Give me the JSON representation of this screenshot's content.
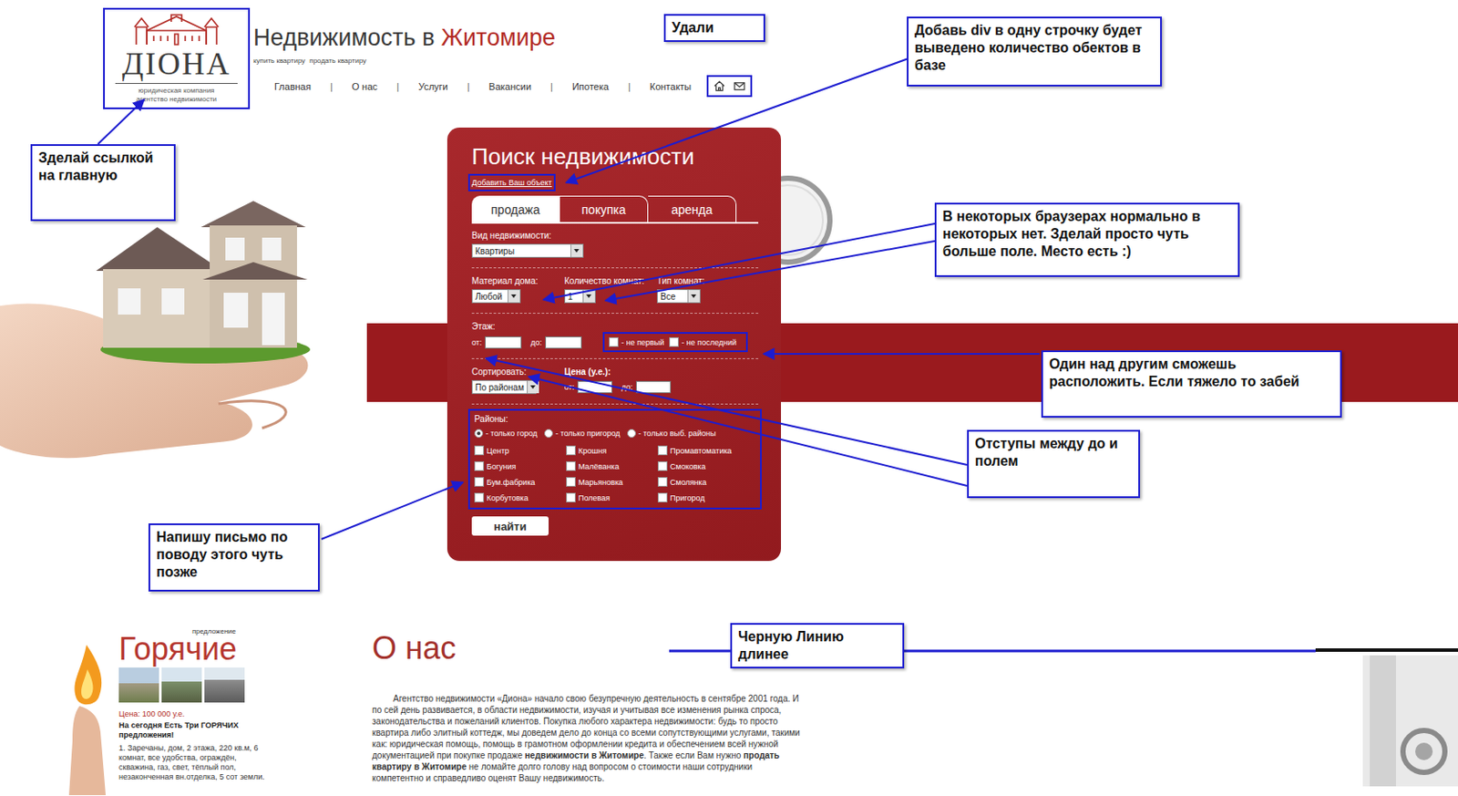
{
  "logo": {
    "name": "ДІОНА",
    "subtitle": [
      "юридическая компания",
      "агентство недвижимости"
    ],
    "highlighted": true
  },
  "site_title": {
    "text": "Недвижимость в ",
    "city": "Житомире"
  },
  "sub_links": [
    "купить квартиру",
    "продать квартиру"
  ],
  "nav": [
    "Главная",
    "О нас",
    "Услуги",
    "Вакансии",
    "Ипотека",
    "Контакты"
  ],
  "nav_separator": "|",
  "header_icons": {
    "highlighted": true
  },
  "search": {
    "title": "Поиск недвижимости",
    "add_link": {
      "label": "Добавить Ваш объект",
      "highlighted": true
    },
    "tabs": [
      {
        "label": "продажа",
        "selected": true
      },
      {
        "label": "покупка",
        "selected": false
      },
      {
        "label": "аренда",
        "selected": false
      }
    ],
    "property_type": {
      "label": "Вид недвижимости:",
      "value": "Квартиры"
    },
    "filters": [
      {
        "label": "Материал дома:",
        "value": "Любой"
      },
      {
        "label": "Количество комнат:",
        "value": "1"
      },
      {
        "label": "Тип комнат:",
        "value": "Все"
      }
    ],
    "floor": {
      "label": "Этаж:",
      "from": "от:",
      "to": "до:",
      "options_highlighted": true,
      "options": [
        {
          "label": "- не первый",
          "checked": false
        },
        {
          "label": "- не последний",
          "checked": false
        }
      ]
    },
    "sort": {
      "label": "Сортировать:",
      "value": "По районам"
    },
    "price": {
      "label": "Цена (у.е.):",
      "from": "от:",
      "to": "до:"
    },
    "districts": {
      "label": "Районы:",
      "highlighted": true,
      "scopes": [
        {
          "label": "- только город",
          "selected": true
        },
        {
          "label": "- только пригород",
          "selected": false
        },
        {
          "label": "- только выб. районы",
          "selected": false
        }
      ],
      "items": [
        {
          "label": "Центр",
          "checked": false
        },
        {
          "label": "Крошня",
          "checked": false
        },
        {
          "label": "Промавтоматика",
          "checked": false
        },
        {
          "label": "Богуния",
          "checked": false
        },
        {
          "label": "Малёванка",
          "checked": false
        },
        {
          "label": "Смоковка",
          "checked": false
        },
        {
          "label": "Бум.фабрика",
          "checked": false
        },
        {
          "label": "Марьяновка",
          "checked": false
        },
        {
          "label": "Смолянка",
          "checked": false
        },
        {
          "label": "Корбутовка",
          "checked": false
        },
        {
          "label": "Полевая",
          "checked": false
        },
        {
          "label": "Пригород",
          "checked": false
        }
      ]
    },
    "submit": "найти"
  },
  "hot": {
    "label": "предложение",
    "title": "Горячие",
    "price": "Цена: 100 000 у.е.",
    "headline": "На сегодня Есть Три ГОРЯЧИХ предложения!",
    "listing": "1. Заречаны, дом, 2 этажа, 220 кв.м, 6 комнат, все удобства, ограждён, скважина, газ, свет, тёплый пол, незаконченная вн.отделка, 5 сот земли."
  },
  "about": {
    "title": "О нас",
    "paragraph": [
      {
        "text": "Агентство недвижимости «Диона» начало свою безупречную деятельность в сентябре 2001 года. И по сей день развивается, в области недвижимости, изучая и учитывая все изменения рынка спроса, законодательства и пожеланий клиентов. Покупка любого характера недвижимости: будь то просто квартира либо элитный коттедж, мы доведем дело до конца со всеми сопутствующими услугами, такими как: юридическая помощь, помощь в грамотном оформлении кредита и обеспечением всей нужной документацией при покупке продаже ",
        "bold": false
      },
      {
        "text": "недвижимости в Житомире",
        "bold": true
      },
      {
        "text": ". Также если Вам нужно ",
        "bold": false
      },
      {
        "text": "продать квартиру в Житомире",
        "bold": true
      },
      {
        "text": " не ломайте долго голову над вопросом о стоимости наши сотрудники компетентно и справедливо оценят Вашу недвижимость.",
        "bold": false
      }
    ]
  },
  "annotations": [
    {
      "text": "Удали"
    },
    {
      "text": "Добавь div в одну строчку будет выведено количество обектов в базе"
    },
    {
      "text": "Зделай ссылкой на главную"
    },
    {
      "text": "В некоторых браузерах нормально в некоторых нет. Зделай просто чуть больше поле. Место есть :)"
    },
    {
      "text": "Один над другим сможешь расположить. Если тяжело то забей"
    },
    {
      "text": "Отступы между до и полем"
    },
    {
      "text": "Напишу письмо по поводу этого чуть позже"
    },
    {
      "text": "Черную Линию длинее"
    }
  ]
}
